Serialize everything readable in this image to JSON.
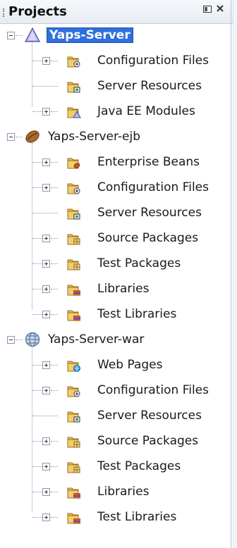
{
  "panel": {
    "title": "Projects"
  },
  "projects": [
    {
      "name": "Yaps-Server",
      "icon": "ear-project-icon",
      "selected": true,
      "children": [
        {
          "label": "Configuration Files",
          "icon": "config-files-folder-icon",
          "expandable": true
        },
        {
          "label": "Server Resources",
          "icon": "server-resources-folder-icon",
          "expandable": false
        },
        {
          "label": "Java EE Modules",
          "icon": "javaee-modules-folder-icon",
          "expandable": true
        }
      ]
    },
    {
      "name": "Yaps-Server-ejb",
      "icon": "ejb-project-icon",
      "selected": false,
      "children": [
        {
          "label": "Enterprise Beans",
          "icon": "enterprise-beans-folder-icon",
          "expandable": true
        },
        {
          "label": "Configuration Files",
          "icon": "config-files-folder-icon",
          "expandable": true
        },
        {
          "label": "Server Resources",
          "icon": "server-resources-folder-icon",
          "expandable": false
        },
        {
          "label": "Source Packages",
          "icon": "source-packages-folder-icon",
          "expandable": true
        },
        {
          "label": "Test Packages",
          "icon": "test-packages-folder-icon",
          "expandable": true
        },
        {
          "label": "Libraries",
          "icon": "libraries-folder-icon",
          "expandable": true
        },
        {
          "label": "Test Libraries",
          "icon": "test-libraries-folder-icon",
          "expandable": true
        }
      ]
    },
    {
      "name": "Yaps-Server-war",
      "icon": "web-project-icon",
      "selected": false,
      "children": [
        {
          "label": "Web Pages",
          "icon": "web-pages-folder-icon",
          "expandable": true
        },
        {
          "label": "Configuration Files",
          "icon": "config-files-folder-icon",
          "expandable": true
        },
        {
          "label": "Server Resources",
          "icon": "server-resources-folder-icon",
          "expandable": false
        },
        {
          "label": "Source Packages",
          "icon": "source-packages-folder-icon",
          "expandable": true
        },
        {
          "label": "Test Packages",
          "icon": "test-packages-folder-icon",
          "expandable": true
        },
        {
          "label": "Libraries",
          "icon": "libraries-folder-icon",
          "expandable": true
        },
        {
          "label": "Test Libraries",
          "icon": "test-libraries-folder-icon",
          "expandable": true
        }
      ]
    }
  ]
}
